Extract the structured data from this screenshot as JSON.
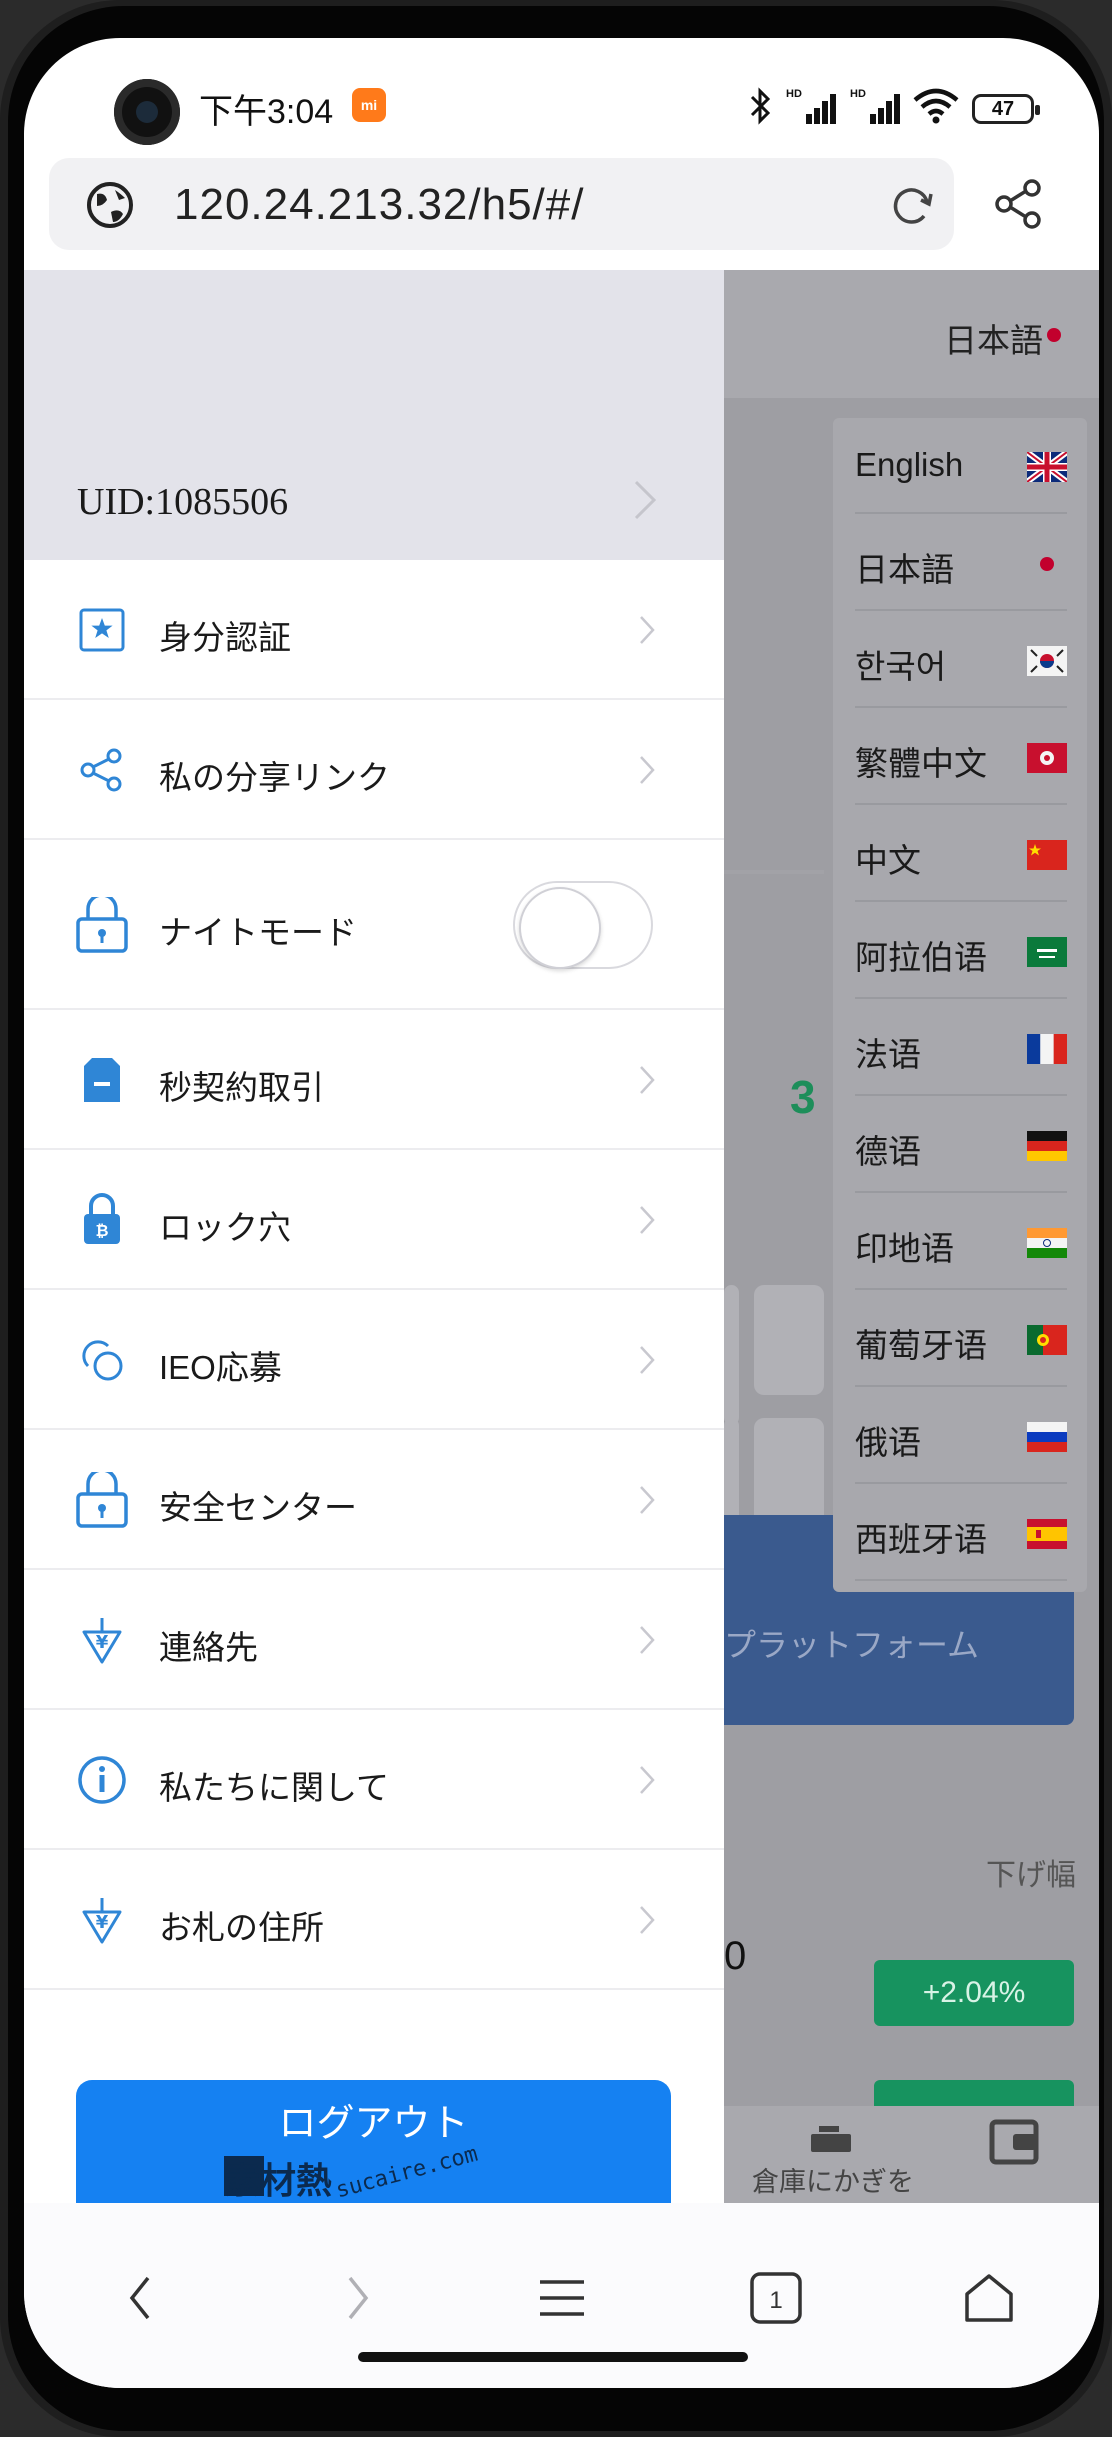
{
  "status_bar": {
    "time": "下午3:04",
    "mi_badge": "mi",
    "signal_1_label": "HD",
    "signal_2_label": "HD",
    "battery": "47"
  },
  "browser": {
    "url": "120.24.213.32/h5/#/"
  },
  "header": {
    "current_language": "日本語"
  },
  "languages": [
    {
      "label": "English",
      "flag": "uk"
    },
    {
      "label": "日本語",
      "flag": "jp"
    },
    {
      "label": "한국어",
      "flag": "kr"
    },
    {
      "label": "繁體中文",
      "flag": "hk"
    },
    {
      "label": "中文",
      "flag": "cn"
    },
    {
      "label": "阿拉伯语",
      "flag": "sa"
    },
    {
      "label": "法语",
      "flag": "fr"
    },
    {
      "label": "德语",
      "flag": "de"
    },
    {
      "label": "印地语",
      "flag": "in"
    },
    {
      "label": "葡萄牙语",
      "flag": "pt"
    },
    {
      "label": "俄语",
      "flag": "ru"
    },
    {
      "label": "西班牙语",
      "flag": "es"
    }
  ],
  "drawer": {
    "uid": "UID:1085506",
    "menu": [
      {
        "label": "身分認証",
        "icon": "id-badge-icon"
      },
      {
        "label": "私の分享リンク",
        "icon": "share-icon"
      },
      {
        "label": "ナイトモード",
        "icon": "lock-icon"
      },
      {
        "label": "秒契約取引",
        "icon": "document-icon"
      },
      {
        "label": "ロック穴",
        "icon": "bitcoin-lock-icon"
      },
      {
        "label": "IEO応募",
        "icon": "circles-icon"
      },
      {
        "label": "安全センター",
        "icon": "lock-icon"
      },
      {
        "label": "連絡先",
        "icon": "yen-download-icon"
      },
      {
        "label": "私たちに関して",
        "icon": "info-icon"
      },
      {
        "label": "お札の住所",
        "icon": "yen-download-icon"
      }
    ],
    "night_mode_on": false,
    "logout_label": "ログアウト"
  },
  "background_page": {
    "number_fragment": "3",
    "banner_text": "プラットフォーム",
    "decline_label": "下げ幅",
    "zero_fragment": "0",
    "change_pct": "+2.04%",
    "tab_lock_label": "倉庫にかぎを かける",
    "tab_assets_label": "資産"
  },
  "watermark": {
    "logo_text": "素材熱",
    "url": "sucaire.com"
  },
  "nav_bar": {
    "tabs_count": "1"
  },
  "colors": {
    "accent": "#1581f2",
    "icon_blue": "#2f86d6",
    "positive": "#17935f"
  }
}
